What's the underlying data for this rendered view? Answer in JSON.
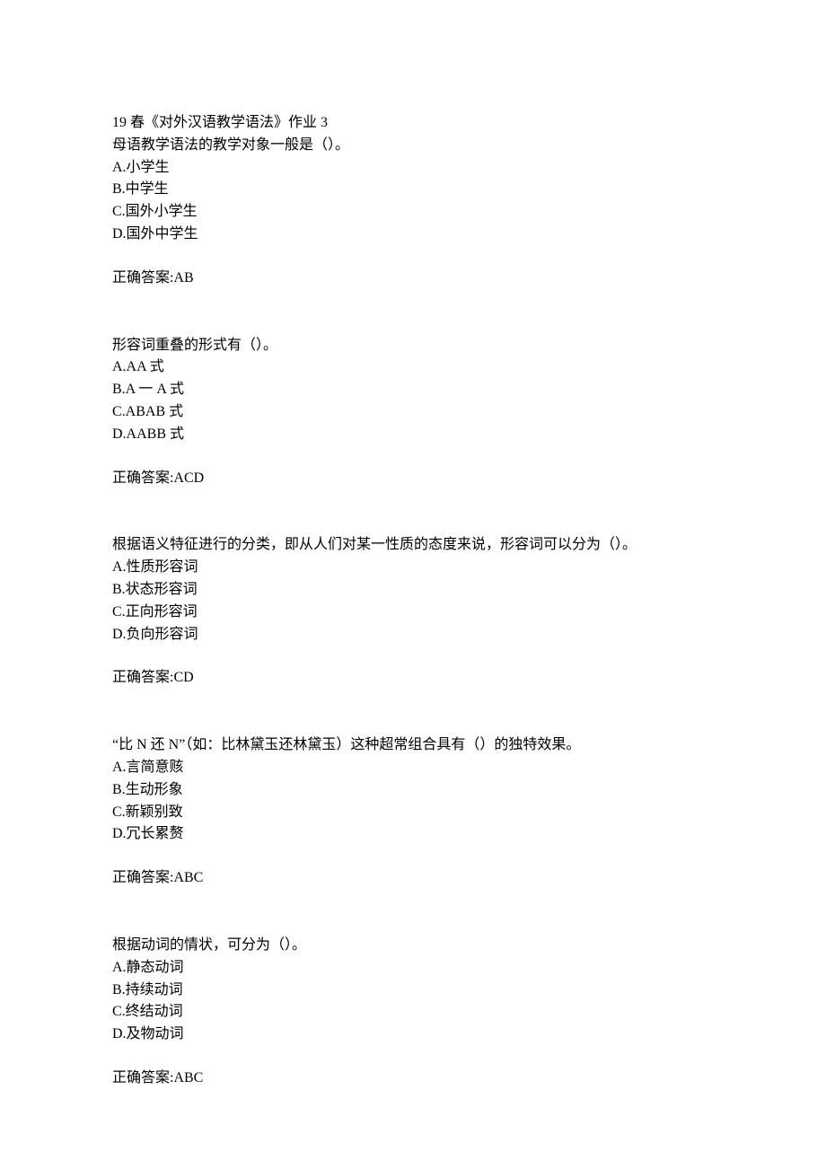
{
  "header": "19 春《对外汉语教学语法》作业 3",
  "questions": [
    {
      "stem": "母语教学语法的教学对象一般是（）。",
      "options": [
        "A.小学生",
        "B.中学生",
        "C.国外小学生",
        "D.国外中学生"
      ],
      "answer": "正确答案:AB"
    },
    {
      "stem": "形容词重叠的形式有（）。",
      "options": [
        "A.AA 式",
        "B.A 一 A 式",
        "C.ABAB 式",
        "D.AABB 式"
      ],
      "answer": "正确答案:ACD"
    },
    {
      "stem": "根据语义特征进行的分类，即从人们对某一性质的态度来说，形容词可以分为（）。",
      "options": [
        "A.性质形容词",
        "B.状态形容词",
        "C.正向形容词",
        "D.负向形容词"
      ],
      "answer": "正确答案:CD"
    },
    {
      "stem": "“比 N 还 N”（如：比林黛玉还林黛玉）这种超常组合具有（）的独特效果。",
      "options": [
        "A.言简意赅",
        "B.生动形象",
        "C.新颖别致",
        "D.冗长累赘"
      ],
      "answer": "正确答案:ABC"
    },
    {
      "stem": "根据动词的情状，可分为（）。",
      "options": [
        "A.静态动词",
        "B.持续动词",
        "C.终结动词",
        "D.及物动词"
      ],
      "answer": "正确答案:ABC"
    }
  ]
}
